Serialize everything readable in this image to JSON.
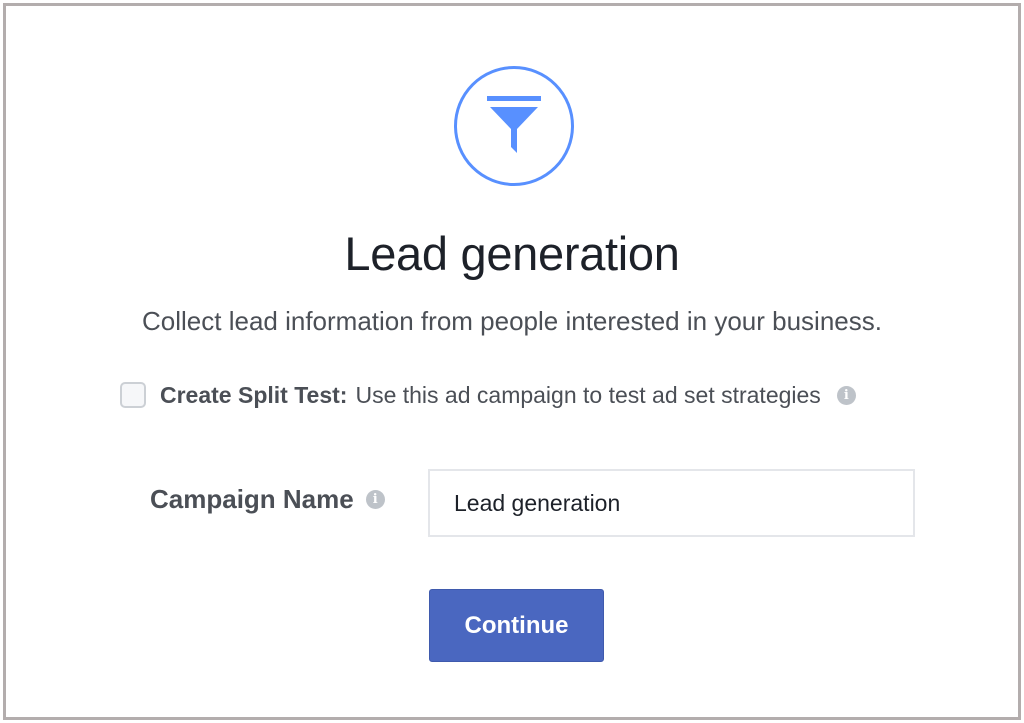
{
  "header": {
    "icon": "funnel-icon",
    "title": "Lead generation",
    "subtitle": "Collect lead information from people interested in your business."
  },
  "split_test": {
    "checked": false,
    "label": "Create Split Test:",
    "description": "Use this ad campaign to test ad set strategies",
    "info_icon": "info-icon"
  },
  "campaign_name": {
    "label": "Campaign Name",
    "value": "Lead generation",
    "info_icon": "info-icon"
  },
  "actions": {
    "continue_label": "Continue"
  },
  "colors": {
    "accent": "#5890ff",
    "button": "#4a67c0",
    "frame_border": "#b3adad"
  }
}
